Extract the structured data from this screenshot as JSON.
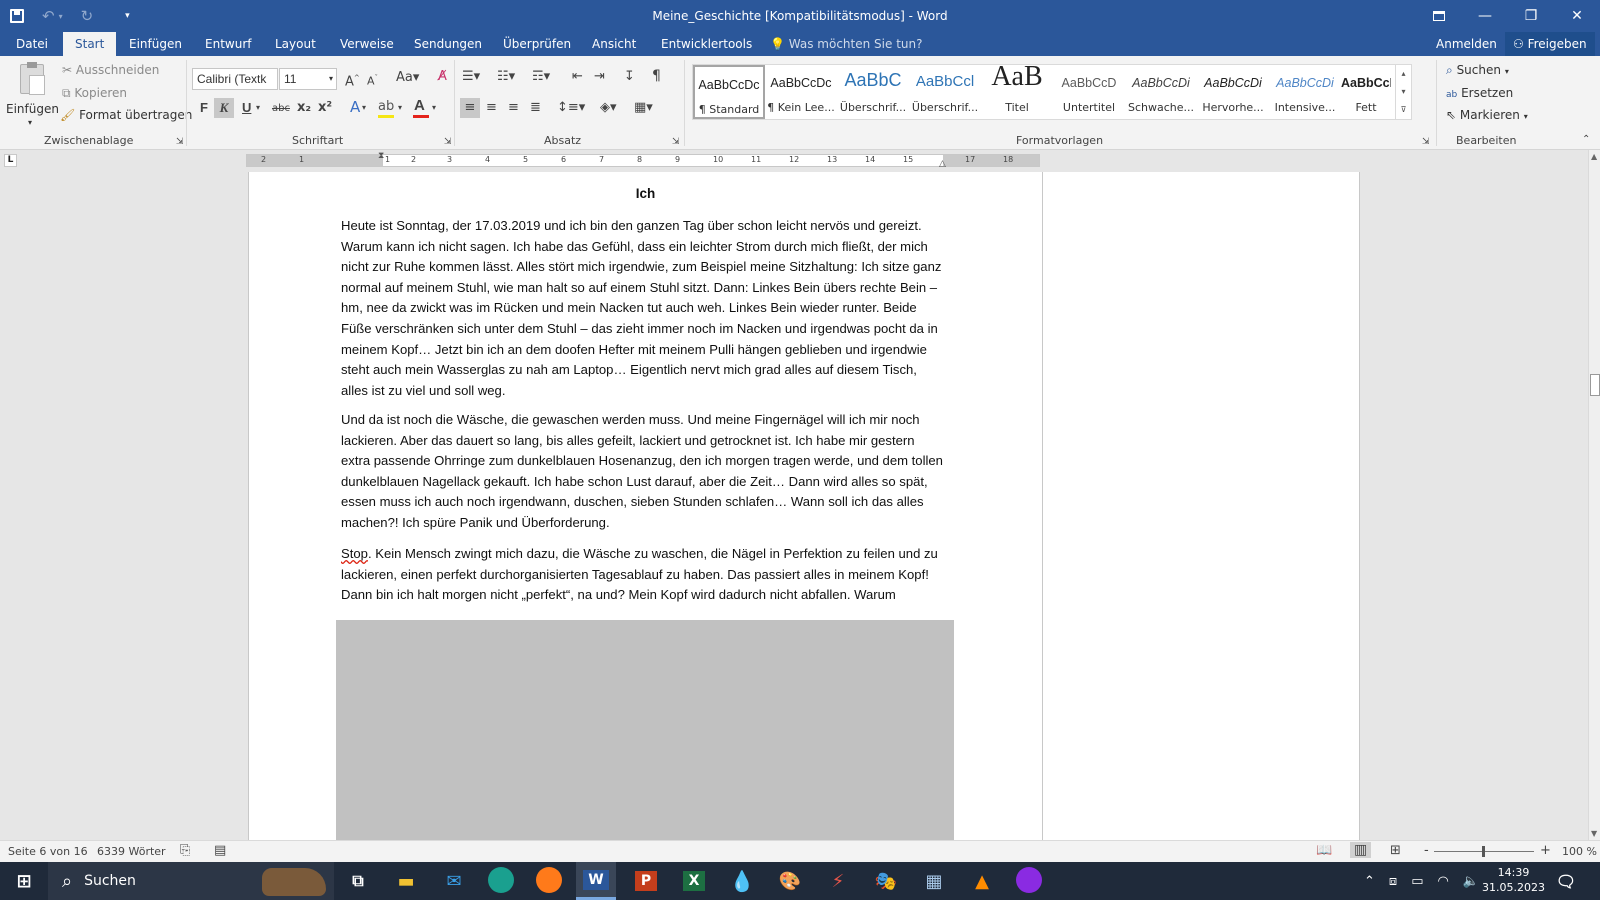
{
  "titlebar": {
    "title": "Meine_Geschichte [Kompatibilitätsmodus] - Word",
    "icons": [
      "save-icon",
      "undo-icon",
      "redo-icon",
      "customize-icon"
    ],
    "controls": [
      "ribbon-display-icon",
      "minimize-icon",
      "restore-icon",
      "close-icon"
    ]
  },
  "tabs": [
    {
      "label": "Datei"
    },
    {
      "label": "Start"
    },
    {
      "label": "Einfügen"
    },
    {
      "label": "Entwurf"
    },
    {
      "label": "Layout"
    },
    {
      "label": "Verweise"
    },
    {
      "label": "Sendungen"
    },
    {
      "label": "Überprüfen"
    },
    {
      "label": "Ansicht"
    },
    {
      "label": "Entwicklertools"
    }
  ],
  "tell_me": "Was möchten Sie tun?",
  "signin": "Anmelden",
  "share": "Freigeben",
  "clipboard": {
    "paste": "Einfügen",
    "cut": "Ausschneiden",
    "copy": "Kopieren",
    "format_painter": "Format übertragen",
    "group": "Zwischenablage"
  },
  "font": {
    "family": "Calibri (Textk",
    "size": "11",
    "bold": "F",
    "italic": "K",
    "underline": "U",
    "strike": "abc",
    "sub": "x₂",
    "sup": "x²",
    "group": "Schriftart"
  },
  "paragraph": {
    "group": "Absatz"
  },
  "styles": {
    "group": "Formatvorlagen",
    "items": [
      {
        "preview": "AaBbCcDc",
        "name": "¶ Standard"
      },
      {
        "preview": "AaBbCcDc",
        "name": "¶ Kein Lee..."
      },
      {
        "preview": "AaBbC",
        "name": "Überschrif..."
      },
      {
        "preview": "AaBbCcl",
        "name": "Überschrif..."
      },
      {
        "preview": "AaB",
        "name": "Titel"
      },
      {
        "preview": "AaBbCcD",
        "name": "Untertitel"
      },
      {
        "preview": "AaBbCcDi",
        "name": "Schwache..."
      },
      {
        "preview": "AaBbCcDi",
        "name": "Hervorhe..."
      },
      {
        "preview": "AaBbCcDi",
        "name": "Intensive..."
      },
      {
        "preview": "AaBbCcDc",
        "name": "Fett"
      }
    ]
  },
  "editing": {
    "find": "Suchen",
    "replace": "Ersetzen",
    "select": "Markieren",
    "group": "Bearbeiten"
  },
  "ruler": {
    "numbers": [
      "2",
      "1",
      "1",
      "2",
      "3",
      "4",
      "5",
      "6",
      "7",
      "8",
      "9",
      "10",
      "11",
      "12",
      "13",
      "14",
      "15",
      "17",
      "18"
    ]
  },
  "document": {
    "heading": "Ich",
    "p1": "Heute ist Sonntag, der 17.03.2019 und ich bin den ganzen Tag über schon leicht nervös und gereizt. Warum kann ich nicht sagen. Ich habe das Gefühl, dass ein leichter Strom durch mich fließt, der mich nicht zur Ruhe kommen lässt. Alles stört mich irgendwie, zum Beispiel meine Sitzhaltung: Ich sitze ganz normal auf meinem Stuhl, wie man halt so auf einem Stuhl sitzt. Dann: Linkes Bein übers rechte Bein – hm, nee da zwickt was im Rücken und mein Nacken tut auch weh. Linkes Bein wieder runter. Beide Füße verschränken sich unter dem Stuhl – das zieht immer noch im Nacken und irgendwas pocht da in meinem Kopf… Jetzt bin ich an dem doofen Hefter mit meinem Pulli hängen geblieben und irgendwie steht auch mein Wasserglas zu nah am Laptop… Eigentlich nervt mich grad alles auf diesem Tisch, alles ist zu viel und soll weg.",
    "p2": "Und da ist noch die Wäsche, die gewaschen werden muss. Und meine Fingernägel will ich mir noch lackieren. Aber das dauert so lang, bis alles gefeilt, lackiert und getrocknet ist. Ich habe mir gestern extra passende Ohrringe zum dunkelblauen Hosenanzug, den ich morgen tragen werde, und dem tollen dunkelblauen Nagellack gekauft. Ich habe schon Lust darauf, aber die Zeit… Dann wird alles so spät, essen muss ich auch noch irgendwann, duschen, sieben Stunden schlafen… Wann soll ich das alles machen?! Ich spüre Panik und Überforderung.",
    "p3_first": "Stop",
    "p3_rest": ". Kein Mensch zwingt mich dazu, die Wäsche zu waschen, die Nägel in Perfektion zu feilen und zu lackieren, einen perfekt durchorganisierten Tagesablauf zu haben. Das passiert alles in meinem Kopf! Dann bin ich halt morgen nicht „perfekt“, na und? Mein Kopf wird dadurch nicht abfallen. Warum"
  },
  "status": {
    "page": "Seite 6 von 16",
    "words": "6339 Wörter",
    "zoom": "100 %",
    "zoom_minus": "-",
    "zoom_plus": "+"
  },
  "taskbar": {
    "search_placeholder": "Suchen",
    "time": "14:39",
    "date": "31.05.2023",
    "apps": [
      "task-view-icon",
      "explorer-icon",
      "mail-icon",
      "edge-icon",
      "firefox-icon",
      "word-icon",
      "powerpoint-icon",
      "excel-icon",
      "paint-icon",
      "photos-icon",
      "tool-icon",
      "app-icon",
      "calculator-icon",
      "vlc-icon",
      "game-icon"
    ],
    "word_letter": "W",
    "ppt_letter": "P",
    "excel_letter": "X"
  },
  "colors": {
    "word_blue": "#2b579a",
    "taskbar": "#1f2a3a",
    "spelling_underline": "#dd2211"
  }
}
